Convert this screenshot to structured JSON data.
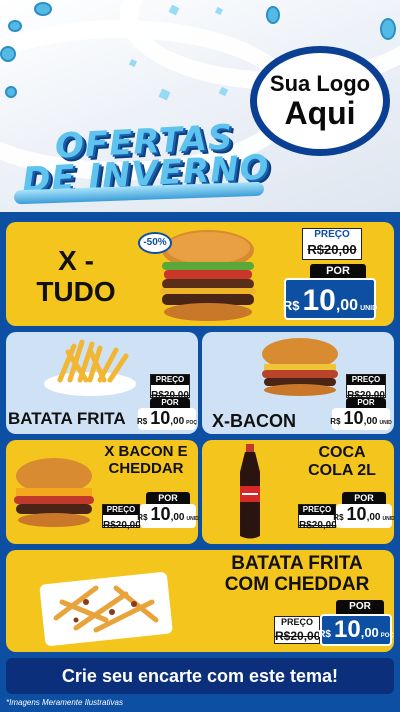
{
  "header": {
    "logo_line1": "Sua Logo",
    "logo_line2": "Aqui",
    "title_line1": "OFERTAS",
    "title_line2": "DE INVERNO"
  },
  "labels": {
    "preco": "PREÇO",
    "por": "POR",
    "rs": "R$",
    "unid": "UNID",
    "poc": "POÇ"
  },
  "products": {
    "xtudo": {
      "name_line1": "X -",
      "name_line2": "TUDO",
      "discount": "-50%",
      "old_price": "R$20,00",
      "price_int": "10",
      "price_cents": ",00"
    },
    "batata": {
      "name": "BATATA FRITA",
      "old_price": "R$20,00",
      "price_int": "10",
      "price_cents": ",00"
    },
    "xbacon": {
      "name": "X-BACON",
      "old_price": "R$20,00",
      "price_int": "10",
      "price_cents": ",00"
    },
    "xbc": {
      "name_line1": "X BACON E",
      "name_line2": "CHEDDAR",
      "old_price": "R$20,00",
      "price_int": "10",
      "price_cents": ",00"
    },
    "coca": {
      "name_line1": "COCA",
      "name_line2": "COLA 2L",
      "old_price": "R$20,00",
      "price_int": "10",
      "price_cents": ",00"
    },
    "batata_cheddar": {
      "name_line1": "BATATA FRITA",
      "name_line2": "COM CHEDDAR",
      "old_price": "R$20,00",
      "price_int": "10",
      "price_cents": ",00"
    }
  },
  "cta": "Crie seu encarte com este tema!",
  "footnote": "*Imagens Meramente Ilustrativas",
  "colors": {
    "brand_blue": "#0d4fa3",
    "yellow": "#f4c51c",
    "light_blue": "#cfe2f5"
  }
}
